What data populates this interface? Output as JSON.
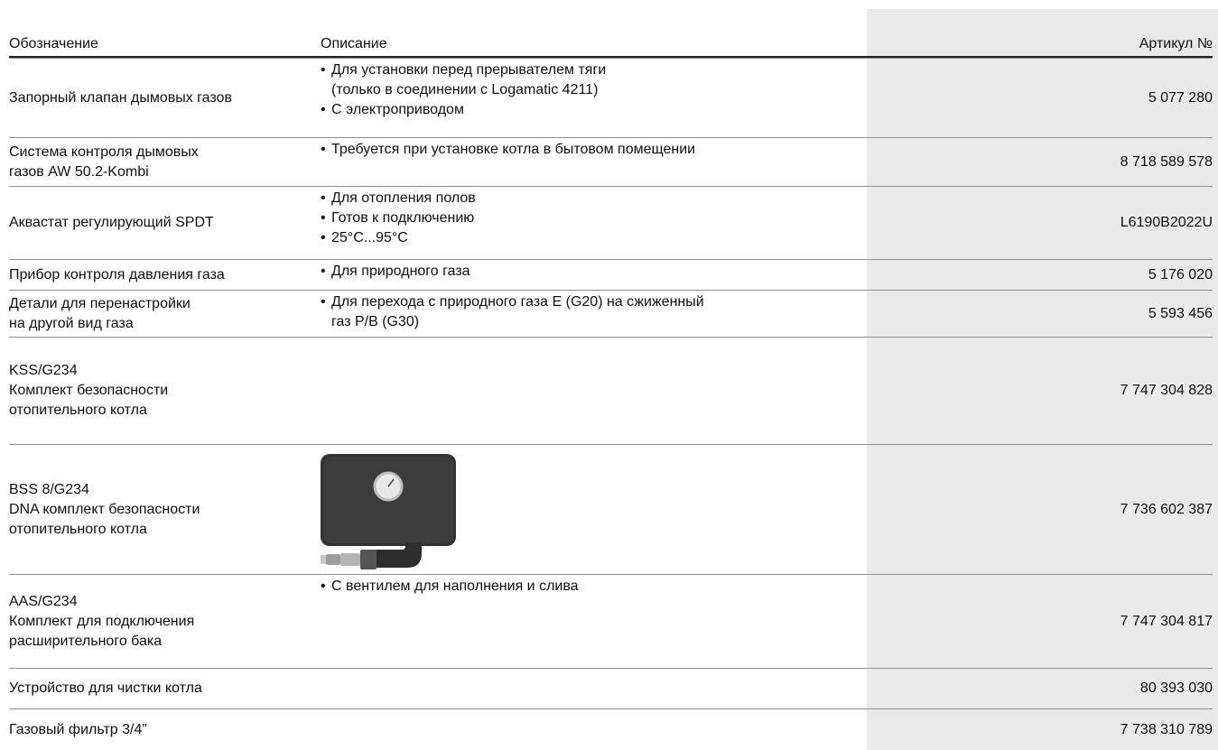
{
  "header": {
    "designation": "Обозначение",
    "description": "Описание",
    "article": "Артикул №"
  },
  "rows": [
    {
      "name": [
        "Запорный клапан дымовых газов"
      ],
      "desc": [
        {
          "t": "Для установки перед прерывателем тяги",
          "b": true
        },
        {
          "t": "(только в соединении с Logamatic 4211)",
          "b": false
        },
        {
          "t": "С электроприводом",
          "b": true
        }
      ],
      "article": "5 077 280"
    },
    {
      "name": [
        "Система контроля дымовых",
        "газов AW 50.2-Kombi"
      ],
      "desc": [
        {
          "t": "Требуется при установке котла в бытовом помещении",
          "b": true
        }
      ],
      "article": "8 718 589 578"
    },
    {
      "name": [
        "Аквастат регулирующий SPDT"
      ],
      "desc": [
        {
          "t": "Для отопления полов",
          "b": true
        },
        {
          "t": "Готов к подключению",
          "b": true
        },
        {
          "t": "25°C...95°C",
          "b": true
        }
      ],
      "article": "L6190B2022U"
    },
    {
      "name": [
        "Прибор контроля давления газа"
      ],
      "desc": [
        {
          "t": "Для природного газа",
          "b": true
        }
      ],
      "article": "5 176 020"
    },
    {
      "name": [
        "Детали для перенастройки",
        "на другой вид газа"
      ],
      "desc": [
        {
          "t": "Для перехода с природного газа E (G20) на сжиженный",
          "b": true
        },
        {
          "t": "газ P/B (G30)",
          "b": false
        }
      ],
      "article": "5 593 456"
    },
    {
      "name": [
        "KSS/G234",
        "Комплект безопасности",
        "отопительного котла"
      ],
      "desc": [],
      "article": "7 747 304 828"
    },
    {
      "name": [
        "BSS 8/G234",
        "DNA комплект безопасности",
        "отопительного котла"
      ],
      "desc": [],
      "image": "safety-kit-photo",
      "article": "7 736 602 387"
    },
    {
      "name": [
        "AAS/G234",
        "Комплект для подключения",
        "расширительного бака"
      ],
      "desc": [
        {
          "t": "С вентилем для наполнения и слива",
          "b": true
        }
      ],
      "article": "7 747 304 817"
    },
    {
      "name": [
        "Устройство для чистки котла"
      ],
      "desc": [],
      "article": "80 393 030"
    },
    {
      "name": [
        "Газовый фильтр 3/4”"
      ],
      "desc": [],
      "article": "7 738 310 789"
    }
  ]
}
